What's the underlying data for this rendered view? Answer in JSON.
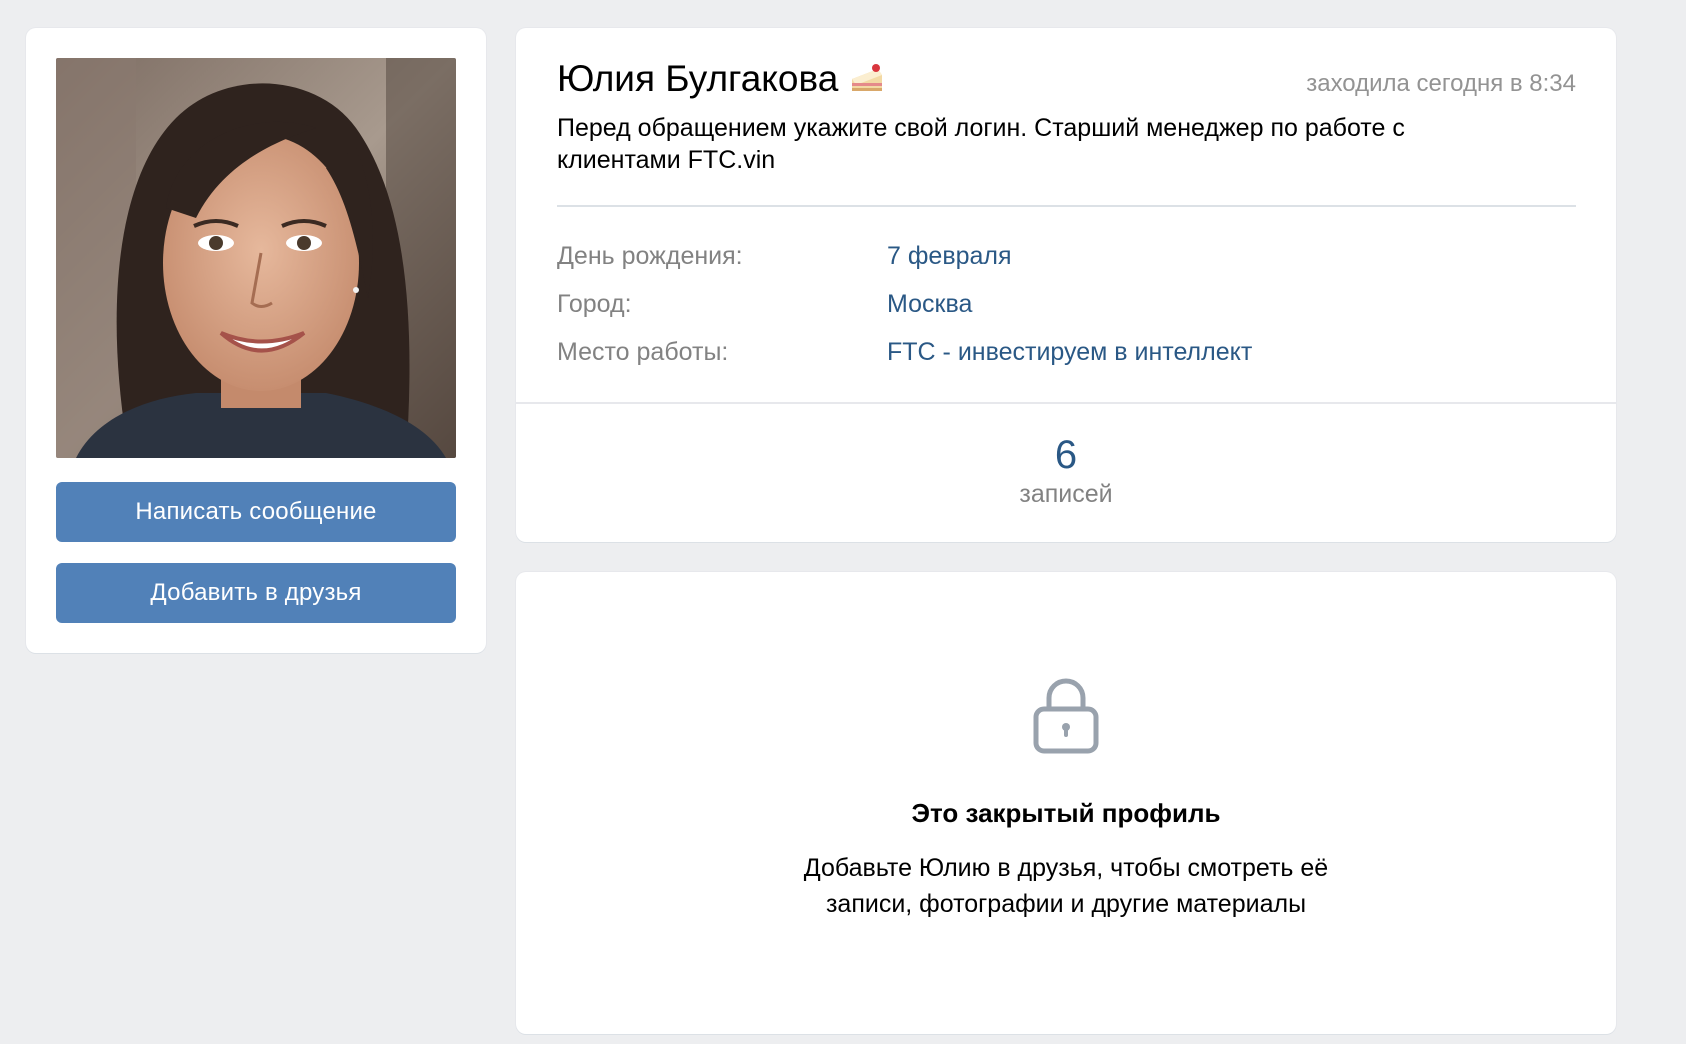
{
  "profile": {
    "name": "Юлия Булгакова",
    "name_emoji": "cake-icon",
    "last_seen": "заходила сегодня в 8:34",
    "status": "Перед обращением укажите свой логин. Старший менеджер по работе с клиентами FTC.vin",
    "avatar": "profile-photo"
  },
  "actions": {
    "message_label": "Написать сообщение",
    "add_friend_label": "Добавить в друзья"
  },
  "info": {
    "birthday_label": "День рождения:",
    "birthday_value": "7 февраля",
    "city_label": "Город:",
    "city_value": "Москва",
    "work_label": "Место работы:",
    "work_value": "FTC - инвестируем в интеллект"
  },
  "counters": {
    "posts_value": "6",
    "posts_label": "записей"
  },
  "closed_profile": {
    "icon": "lock-icon",
    "title": "Это закрытый профиль",
    "description": "Добавьте Юлию в друзья, чтобы смотреть её записи, фотографии и другие материалы"
  },
  "colors": {
    "background": "#edeef0",
    "button": "#5181b8",
    "link": "#2a5885",
    "muted": "#828282"
  }
}
